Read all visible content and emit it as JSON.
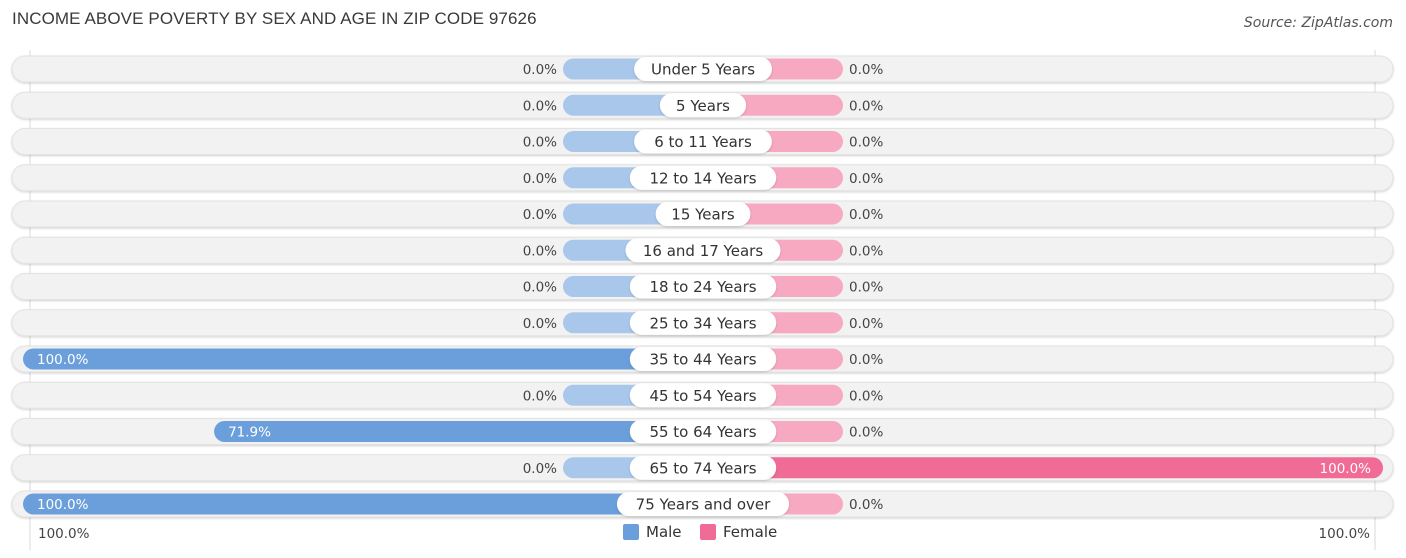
{
  "header": {
    "title": "INCOME ABOVE POVERTY BY SEX AND AGE IN ZIP CODE 97626",
    "source": "Source: ZipAtlas.com"
  },
  "legend": {
    "male_label": "Male",
    "female_label": "Female"
  },
  "axis": {
    "left_label": "100.0%",
    "right_label": "100.0%"
  },
  "colors": {
    "male": "#6a9fdb",
    "male_light": "#a9c7eb",
    "female": "#f06b95",
    "female_light": "#f6a9c1",
    "track": "#f2f2f2"
  },
  "chart_data": {
    "type": "bar",
    "orientation": "horizontal-diverging",
    "title": "INCOME ABOVE POVERTY BY SEX AND AGE IN ZIP CODE 97626",
    "xlabel": "",
    "ylabel": "",
    "xlim": [
      -100,
      100
    ],
    "legend_position": "bottom-center",
    "categories": [
      "Under 5 Years",
      "5 Years",
      "6 to 11 Years",
      "12 to 14 Years",
      "15 Years",
      "16 and 17 Years",
      "18 to 24 Years",
      "25 to 34 Years",
      "35 to 44 Years",
      "45 to 54 Years",
      "55 to 64 Years",
      "65 to 74 Years",
      "75 Years and over"
    ],
    "series": [
      {
        "name": "Male",
        "values": [
          0.0,
          0.0,
          0.0,
          0.0,
          0.0,
          0.0,
          0.0,
          0.0,
          100.0,
          0.0,
          71.9,
          0.0,
          100.0
        ],
        "labels": [
          "0.0%",
          "0.0%",
          "0.0%",
          "0.0%",
          "0.0%",
          "0.0%",
          "0.0%",
          "0.0%",
          "100.0%",
          "0.0%",
          "71.9%",
          "0.0%",
          "100.0%"
        ]
      },
      {
        "name": "Female",
        "values": [
          0.0,
          0.0,
          0.0,
          0.0,
          0.0,
          0.0,
          0.0,
          0.0,
          0.0,
          0.0,
          0.0,
          100.0,
          0.0
        ],
        "labels": [
          "0.0%",
          "0.0%",
          "0.0%",
          "0.0%",
          "0.0%",
          "0.0%",
          "0.0%",
          "0.0%",
          "0.0%",
          "0.0%",
          "0.0%",
          "100.0%",
          "0.0%"
        ]
      }
    ],
    "x_tick_labels": [
      "100.0%",
      "100.0%"
    ]
  }
}
